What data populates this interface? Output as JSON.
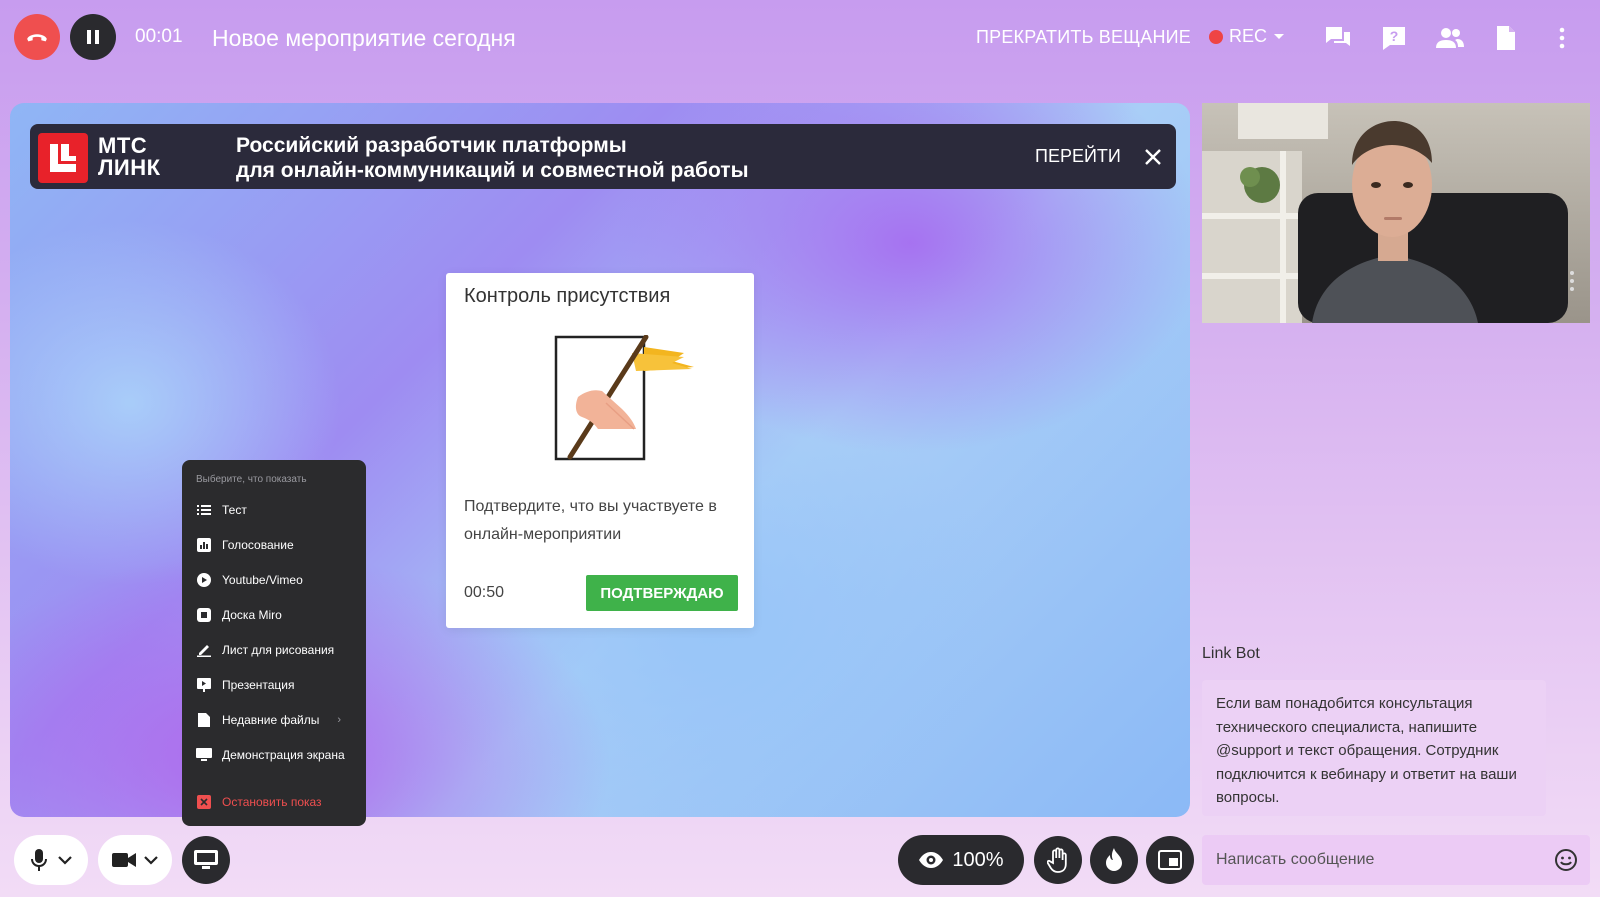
{
  "header": {
    "timer": "00:01",
    "title": "Новое мероприятие сегодня",
    "stop_broadcast": "ПРЕКРАТИТЬ ВЕЩАНИЕ",
    "rec_label": "REC",
    "icons": [
      "chat-icon",
      "help-icon",
      "participants-icon",
      "document-icon",
      "more-icon"
    ]
  },
  "banner": {
    "brand_line1": "МТС",
    "brand_line2": "ЛИНК",
    "text_line1": "Российский разработчик платформы",
    "text_line2": "для онлайн-коммуникаций и совместной работы",
    "go_label": "ПЕРЕЙТИ"
  },
  "attendance": {
    "title": "Контроль присутствия",
    "text": "Подтвердите, что вы участвуете в онлайн-мероприятии",
    "countdown": "00:50",
    "confirm_label": "ПОДТВЕРЖДАЮ"
  },
  "share_menu": {
    "header": "Выберите, что показать",
    "items": [
      {
        "label": "Тест",
        "icon": "list-icon"
      },
      {
        "label": "Голосование",
        "icon": "poll-icon"
      },
      {
        "label": "Youtube/Vimeo",
        "icon": "play-icon"
      },
      {
        "label": "Доска Miro",
        "icon": "board-icon"
      },
      {
        "label": "Лист для рисования",
        "icon": "pen-icon"
      },
      {
        "label": "Презентация",
        "icon": "presentation-icon"
      },
      {
        "label": "Недавние файлы",
        "icon": "file-icon"
      },
      {
        "label": "Демонстрация экрана",
        "icon": "monitor-icon"
      }
    ],
    "stop_label": "Остановить показ"
  },
  "chat": {
    "author": "Link Bot",
    "message": "Если вам понадобится консультация технического специалиста, напишите @support и текст обращения. Сотрудник подключится к вебинару и ответит на ваши вопросы.",
    "input_placeholder": "Написать сообщение"
  },
  "controls": {
    "view_percent": "100%"
  },
  "colors": {
    "hangup": "#ef4f4f",
    "rec_dot": "#ef4444",
    "confirm": "#3fb24a",
    "brand_red": "#e8222a"
  }
}
